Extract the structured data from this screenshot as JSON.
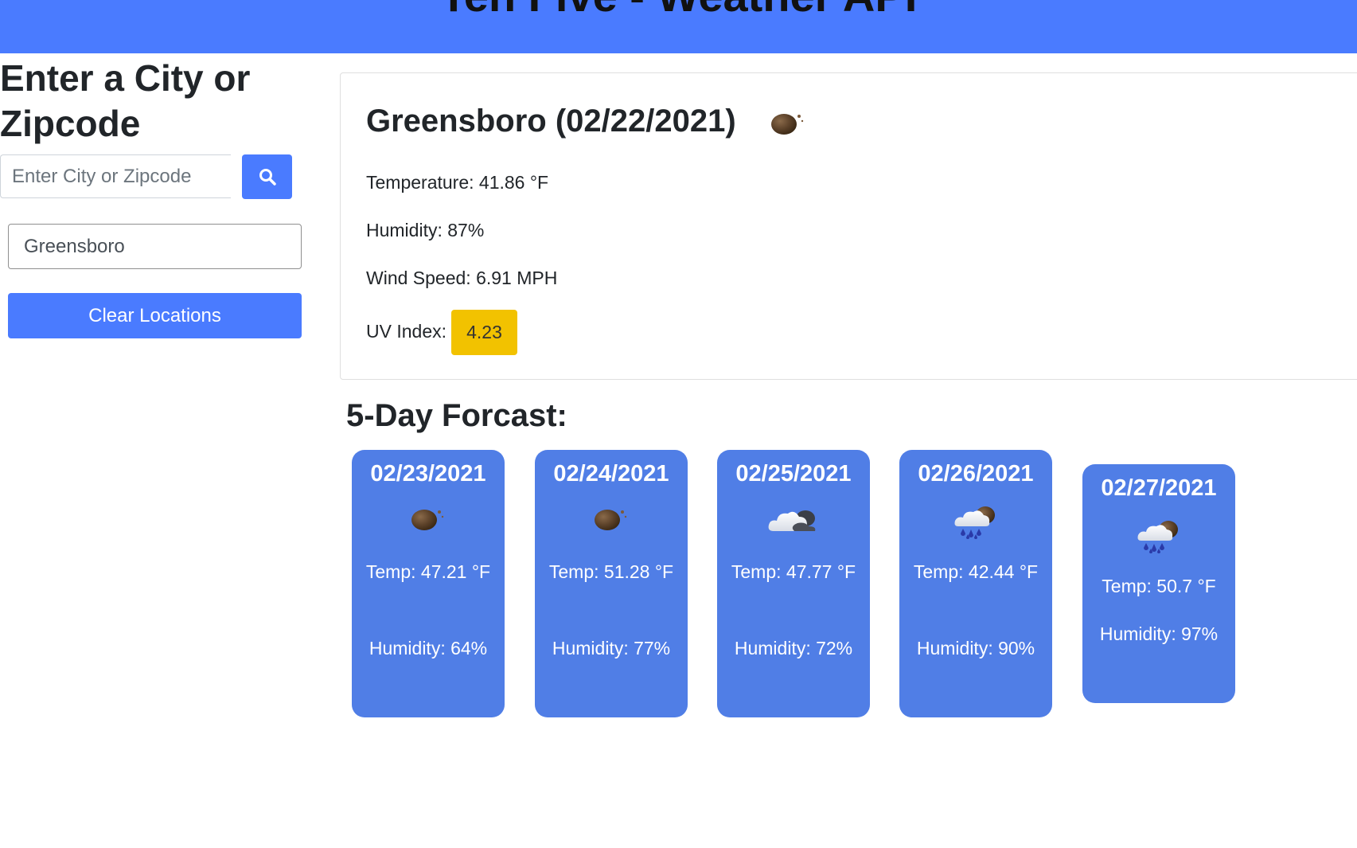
{
  "header": {
    "title": "Ten Five - Weather API"
  },
  "sidebar": {
    "heading": "Enter a City or Zipcode",
    "search_placeholder": "Enter City or Zipcode",
    "history": [
      "Greensboro"
    ],
    "clear_label": "Clear Locations"
  },
  "current": {
    "title": "Greensboro (02/22/2021)",
    "icon": "clear-night-icon",
    "temperature": "Temperature: 41.86 °F",
    "humidity": "Humidity: 87%",
    "wind": "Wind Speed: 6.91 MPH",
    "uv_label": "UV Index:",
    "uv_value": "4.23"
  },
  "forecast": {
    "heading": "5-Day Forcast:",
    "days": [
      {
        "date": "02/23/2021",
        "icon": "clear-night-icon",
        "temp": "Temp: 47.21 °F",
        "humidity": "Humidity: 64%"
      },
      {
        "date": "02/24/2021",
        "icon": "clear-night-icon",
        "temp": "Temp: 51.28 °F",
        "humidity": "Humidity: 77%"
      },
      {
        "date": "02/25/2021",
        "icon": "cloudy-night-icon",
        "temp": "Temp: 47.77 °F",
        "humidity": "Humidity: 72%"
      },
      {
        "date": "02/26/2021",
        "icon": "rain-night-icon",
        "temp": "Temp: 42.44 °F",
        "humidity": "Humidity: 90%"
      },
      {
        "date": "02/27/2021",
        "icon": "rain-night-icon",
        "temp": "Temp: 50.7 °F",
        "humidity": "Humidity: 97%"
      }
    ]
  },
  "colors": {
    "primary": "#4a7bff",
    "forecast_card": "#507ee6",
    "uv_moderate": "#f2c200"
  }
}
